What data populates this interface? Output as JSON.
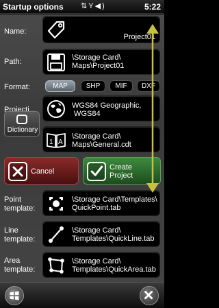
{
  "window": {
    "title": "Startup options",
    "time": "5:22"
  },
  "fields": {
    "name": {
      "label": "Name:",
      "value": "Project01"
    },
    "path": {
      "label": "Path:",
      "value": "\\Storage Card\\\nMaps\\Project01"
    },
    "format": {
      "label": "Format:",
      "options": [
        "MAP",
        "SHP",
        "MIF",
        "DXF"
      ],
      "selected": "MAP"
    },
    "projection": {
      "label": "Projecti...",
      "value": "WGS84 Geographic,\n WGS84"
    },
    "dictionary": {
      "label": "Dictionary",
      "value": "\\Storage Card\\\nMaps\\General.cdt"
    },
    "point_template": {
      "label": "Point\ntemplate:",
      "value": "\\Storage Card\\Templates\\\nQuickPoint.tab"
    },
    "line_template": {
      "label": "Line\ntemplate:",
      "value": "\\Storage Card\\\nTemplates\\QuickLine.tab"
    },
    "area_template": {
      "label": "Area\ntemplate:",
      "value": "\\Storage Card\\\nTemplates\\QuickArea.tab"
    }
  },
  "buttons": {
    "cancel": "Cancel",
    "create": "Create\nProject"
  },
  "icons": [
    "tag-icon",
    "floppy-disk-icon",
    "globe-icon",
    "dictionary-book-icon",
    "point-icon",
    "line-icon",
    "area-icon",
    "signal-icon",
    "volume-icon",
    "windows-start-icon",
    "close-icon"
  ],
  "colors": {
    "cancel": "#6a1e1e",
    "create": "#2e6e2e",
    "scroll_arrow": "#c8c040",
    "selected_format": "#7a838c"
  }
}
